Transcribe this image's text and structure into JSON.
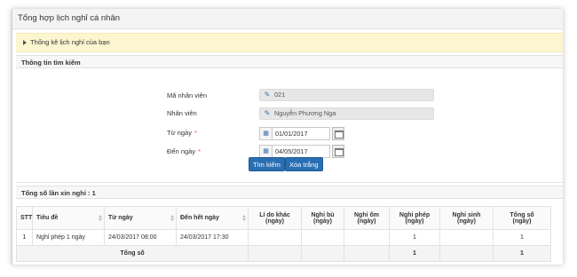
{
  "page_title": "Tổng hợp lịch nghỉ cá nhân",
  "notice": "Thống kê lịch nghỉ của bạn",
  "search": {
    "section_title": "Thông tin tìm kiếm",
    "employee_code_label": "Mã nhân viên",
    "employee_code_value": "021",
    "employee_label": "Nhân viên",
    "employee_value": "Nguyễn Phương Nga",
    "from_label": "Từ ngày",
    "from_value": "01/01/2017",
    "to_label": "Đến ngày",
    "to_value": "04/05/2017",
    "required_mark": "*",
    "search_button": "Tìm kiếm",
    "clear_button": "Xóa trắng"
  },
  "results": {
    "count_label": "Tổng số lần xin nghỉ :",
    "count_value": "1",
    "columns": {
      "stt": "STT",
      "title": "Tiêu đề",
      "from": "Từ ngày",
      "to": "Đến hết ngày",
      "other_1": "Lí do khác",
      "other_2": "(ngày)",
      "comp_1": "Nghỉ bù",
      "comp_2": "(ngày)",
      "sick_1": "Nghỉ ốm",
      "sick_2": "(ngày)",
      "annual_1": "Nghỉ phép",
      "annual_2": "(ngày)",
      "mat_1": "Nghỉ sinh",
      "mat_2": "(ngày)",
      "total_1": "Tổng số",
      "total_2": "(ngày)"
    },
    "rows": [
      {
        "stt": "1",
        "title": "Nghỉ phép 1 ngày",
        "from": "24/03/2017 08:00",
        "to": "24/03/2017 17:30",
        "other": "",
        "comp": "",
        "sick": "",
        "annual": "1",
        "mat": "",
        "total": "1"
      }
    ],
    "total_row": {
      "label": "Tổng số",
      "annual": "1",
      "total": "1"
    }
  },
  "icons": {
    "pencil": "pencil-icon",
    "calendar": "calendar-icon",
    "triangle": "triangle-right-icon",
    "sort": "sort-icon"
  },
  "colors": {
    "primary_button": "#2a6fb3",
    "notice_bg": "#fcf6d0",
    "required": "#d9534f"
  }
}
